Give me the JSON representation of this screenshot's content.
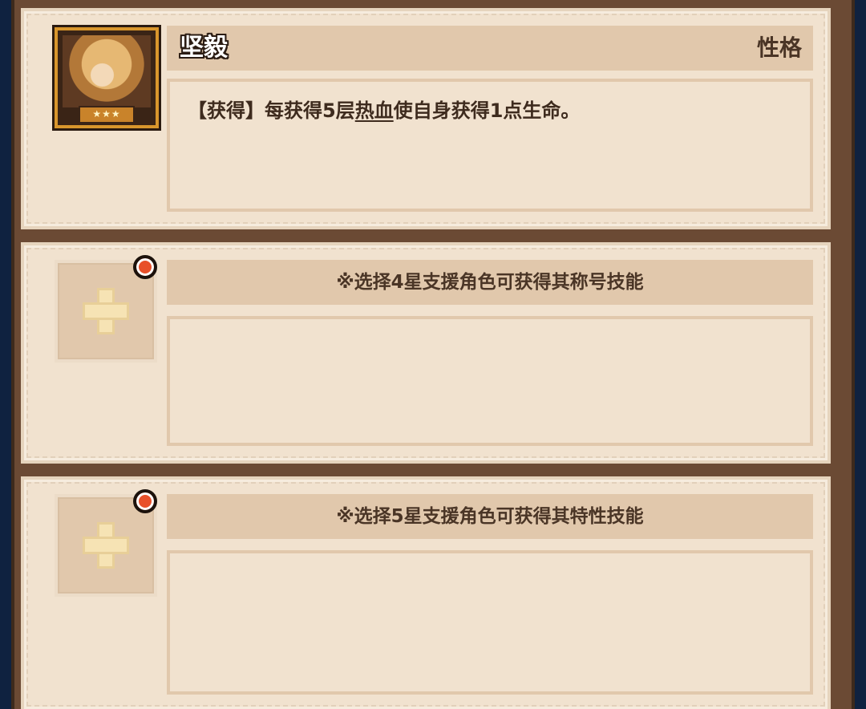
{
  "trait": {
    "name": "坚毅",
    "type": "性格",
    "stars": "★★★",
    "desc_prefix": "【获得】每获得5层",
    "desc_keyword": "热血",
    "desc_suffix": "使自身获得1点生命。"
  },
  "slots": [
    {
      "hint": "※选择4星支援角色可获得其称号技能"
    },
    {
      "hint": "※选择5星支援角色可获得其特性技能"
    }
  ],
  "colors": {
    "background": "#0f2240",
    "frame": "#6b4a34",
    "card": "#f1e2cf",
    "bar": "#e1c8ac",
    "notification_dot": "#e8502a"
  }
}
